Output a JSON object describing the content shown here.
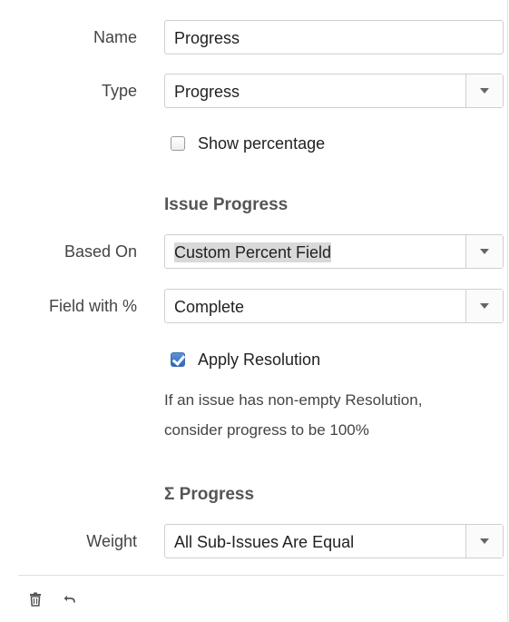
{
  "form": {
    "name": {
      "label": "Name",
      "value": "Progress"
    },
    "type": {
      "label": "Type",
      "value": "Progress"
    },
    "show_percentage": {
      "label": "Show percentage",
      "checked": false
    },
    "issue_progress_heading": "Issue Progress",
    "based_on": {
      "label": "Based On",
      "value": "Custom Percent Field"
    },
    "field_with_percent": {
      "label": "Field with %",
      "value": "Complete"
    },
    "apply_resolution": {
      "label": "Apply Resolution",
      "checked": true
    },
    "resolution_help": {
      "line1": "If an issue has non-empty Resolution,",
      "line2": "consider progress to be 100%"
    },
    "sigma_progress_heading": "Σ Progress",
    "weight": {
      "label": "Weight",
      "value": "All Sub-Issues Are Equal"
    }
  },
  "footer": {
    "icons": [
      "trash-icon",
      "undo-icon"
    ]
  }
}
